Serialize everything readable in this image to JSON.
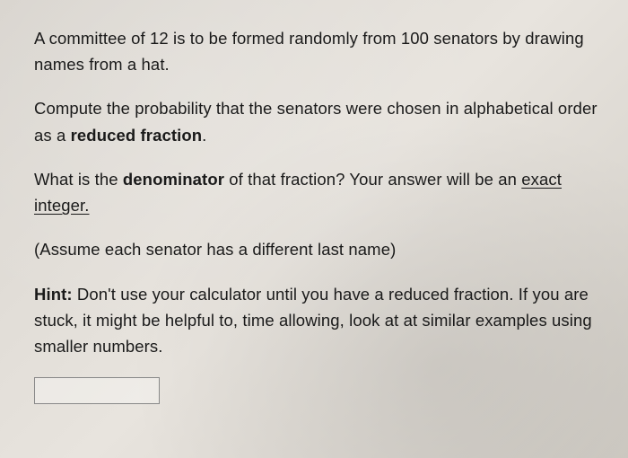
{
  "question": {
    "para1": "A committee of 12 is to be formed randomly from 100 senators by drawing names from a hat.",
    "para2_prefix": "Compute the probability that the senators were chosen in alphabetical order as a ",
    "para2_bold": "reduced fraction",
    "para2_suffix": ".",
    "para3_prefix": "What is the ",
    "para3_bold": "denominator",
    "para3_mid": " of that fraction? Your answer will be an ",
    "para3_underline1": "exact",
    "para3_underline2": "integer.",
    "para4": "(Assume each senator has a different last name)",
    "para5_prefix": "Hint:",
    "para5_rest": " Don't use your calculator until you have a reduced fraction. If you are stuck, it might be helpful to, time allowing, look at at similar examples using smaller numbers."
  }
}
